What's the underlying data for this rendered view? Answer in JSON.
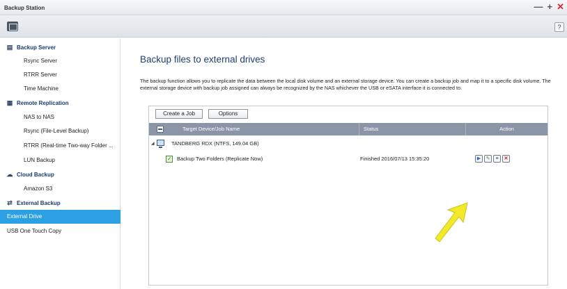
{
  "window": {
    "title": "Backup Station",
    "minimize": "—",
    "maximize": "+",
    "close": "✕",
    "help": "?"
  },
  "sidebar": {
    "items": [
      {
        "label": "Backup Server",
        "type": "cat",
        "icon": "server-icon",
        "glyph": "▤"
      },
      {
        "label": "Rsync Server",
        "type": "sub"
      },
      {
        "label": "RTRR Server",
        "type": "sub"
      },
      {
        "label": "Time Machine",
        "type": "sub"
      },
      {
        "label": "Remote Replication",
        "type": "cat",
        "icon": "replication-icon",
        "glyph": "▦"
      },
      {
        "label": "NAS to NAS",
        "type": "sub"
      },
      {
        "label": "Rsync (File-Level Backup)",
        "type": "sub"
      },
      {
        "label": "RTRR (Real-time Two-way Folder ...",
        "type": "sub"
      },
      {
        "label": "LUN Backup",
        "type": "sub"
      },
      {
        "label": "Cloud Backup",
        "type": "cat",
        "icon": "cloud-icon",
        "glyph": "☁"
      },
      {
        "label": "Amazon S3",
        "type": "sub"
      },
      {
        "label": "External Backup",
        "type": "cat",
        "icon": "sync-arrows-icon",
        "glyph": "⇄"
      },
      {
        "label": "External Drive",
        "type": "sub",
        "active": true
      },
      {
        "label": "USB One Touch Copy",
        "type": "sub"
      }
    ]
  },
  "main": {
    "heading": "Backup files to external drives",
    "description": "The backup function allows you to replicate the data between the local disk volume and an external storage device. You can create a backup job and map it to a specific disk volume. The external storage device with backup job assigned can always be recognized by the NAS whichever the USB or eSATA interface it is connected to.",
    "buttons": {
      "create": "Create a Job",
      "options": "Options"
    },
    "columns": {
      "device": "Target Device/Job Name",
      "status": "Status",
      "action": "Action"
    },
    "device_row": {
      "name": "TANDBERG RDX (NTFS, 149.04 GB)"
    },
    "job_row": {
      "name": "Backup Two Folders (Replicate Now)",
      "status": "Finished 2016/07/13 15:35:20"
    },
    "actions": [
      "play-icon",
      "edit-icon",
      "log-icon",
      "delete-icon"
    ]
  },
  "colors": {
    "accent": "#2d9fe3",
    "header": "#8a96a8",
    "arrow": "#f0ea28"
  }
}
